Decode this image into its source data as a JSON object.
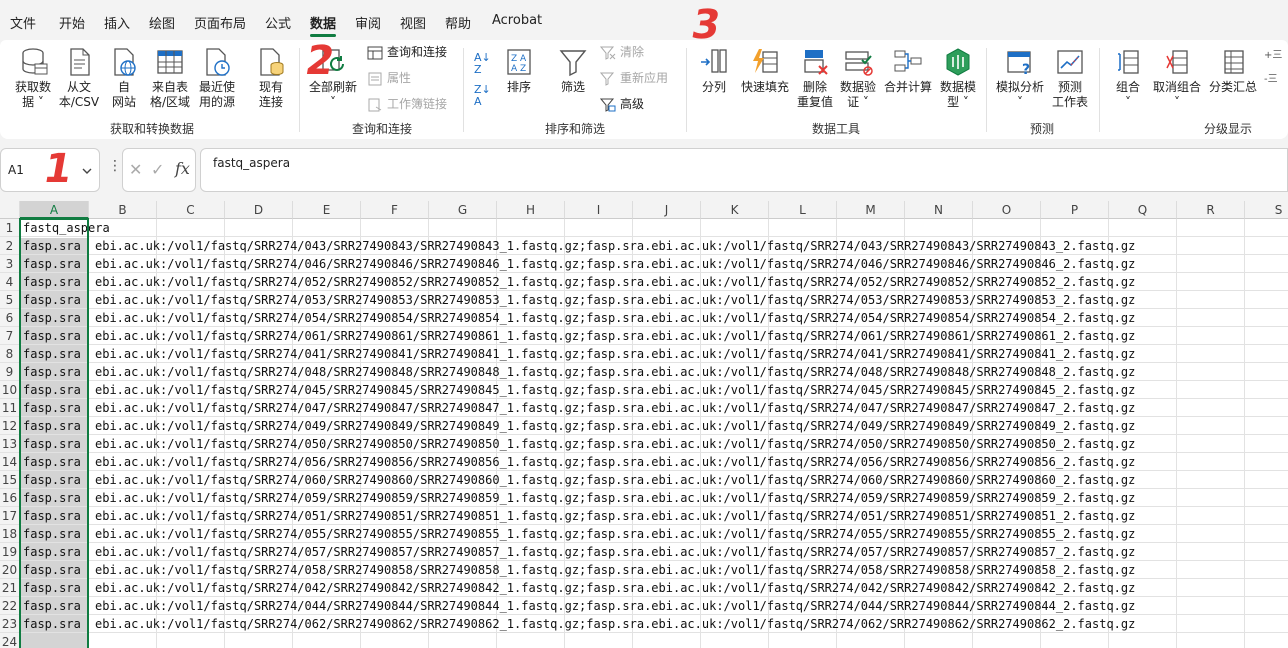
{
  "menu": {
    "tabs": [
      "文件",
      "开始",
      "插入",
      "绘图",
      "页面布局",
      "公式",
      "数据",
      "审阅",
      "视图",
      "帮助",
      "Acrobat"
    ],
    "active": "数据"
  },
  "ribbon": {
    "groups": {
      "get_transform": "获取和转换数据",
      "queries": "查询和连接",
      "sort_filter": "排序和筛选",
      "data_tools": "数据工具",
      "forecast": "预测",
      "outline": "分级显示"
    },
    "buttons": {
      "get_data": "获取数\n据 ˅",
      "from_csv": "从文\n本/CSV",
      "from_web": "自\n网站",
      "from_table": "来自表\n格/区域",
      "recent_sources": "最近使\n用的源",
      "existing_conn": "现有\n连接",
      "refresh_all": "全部刷新\n˅",
      "sort": "排序",
      "filter": "筛选",
      "text_to_columns": "分列",
      "flash_fill": "快速填充",
      "remove_dup": "删除\n重复值",
      "data_validation": "数据验\n证 ˅",
      "consolidate": "合并计算",
      "data_model": "数据模\n型 ˅",
      "what_if": "模拟分析\n˅",
      "forecast_sheet": "预测\n工作表",
      "group": "组合\n˅",
      "ungroup": "取消组合\n˅",
      "subtotal": "分类汇总"
    },
    "small": {
      "queries_conn": "查询和连接",
      "properties": "属性",
      "edit_links": "工作簿链接",
      "clear": "清除",
      "reapply": "重新应用",
      "advanced": "高级"
    }
  },
  "namebox": {
    "value": "A1"
  },
  "formula": {
    "value": "fastq_aspera"
  },
  "columns": [
    "A",
    "B",
    "C",
    "D",
    "E",
    "F",
    "G",
    "H",
    "I",
    "J",
    "K",
    "L",
    "M",
    "N",
    "O",
    "P",
    "Q",
    "R",
    "S"
  ],
  "rows": {
    "header": "fastq_aspera",
    "prefix": "fasp.sra",
    "values": [
      "ebi.ac.uk:/vol1/fastq/SRR274/043/SRR27490843/SRR27490843_1.fastq.gz;fasp.sra.ebi.ac.uk:/vol1/fastq/SRR274/043/SRR27490843/SRR27490843_2.fastq.gz",
      "ebi.ac.uk:/vol1/fastq/SRR274/046/SRR27490846/SRR27490846_1.fastq.gz;fasp.sra.ebi.ac.uk:/vol1/fastq/SRR274/046/SRR27490846/SRR27490846_2.fastq.gz",
      "ebi.ac.uk:/vol1/fastq/SRR274/052/SRR27490852/SRR27490852_1.fastq.gz;fasp.sra.ebi.ac.uk:/vol1/fastq/SRR274/052/SRR27490852/SRR27490852_2.fastq.gz",
      "ebi.ac.uk:/vol1/fastq/SRR274/053/SRR27490853/SRR27490853_1.fastq.gz;fasp.sra.ebi.ac.uk:/vol1/fastq/SRR274/053/SRR27490853/SRR27490853_2.fastq.gz",
      "ebi.ac.uk:/vol1/fastq/SRR274/054/SRR27490854/SRR27490854_1.fastq.gz;fasp.sra.ebi.ac.uk:/vol1/fastq/SRR274/054/SRR27490854/SRR27490854_2.fastq.gz",
      "ebi.ac.uk:/vol1/fastq/SRR274/061/SRR27490861/SRR27490861_1.fastq.gz;fasp.sra.ebi.ac.uk:/vol1/fastq/SRR274/061/SRR27490861/SRR27490861_2.fastq.gz",
      "ebi.ac.uk:/vol1/fastq/SRR274/041/SRR27490841/SRR27490841_1.fastq.gz;fasp.sra.ebi.ac.uk:/vol1/fastq/SRR274/041/SRR27490841/SRR27490841_2.fastq.gz",
      "ebi.ac.uk:/vol1/fastq/SRR274/048/SRR27490848/SRR27490848_1.fastq.gz;fasp.sra.ebi.ac.uk:/vol1/fastq/SRR274/048/SRR27490848/SRR27490848_2.fastq.gz",
      "ebi.ac.uk:/vol1/fastq/SRR274/045/SRR27490845/SRR27490845_1.fastq.gz;fasp.sra.ebi.ac.uk:/vol1/fastq/SRR274/045/SRR27490845/SRR27490845_2.fastq.gz",
      "ebi.ac.uk:/vol1/fastq/SRR274/047/SRR27490847/SRR27490847_1.fastq.gz;fasp.sra.ebi.ac.uk:/vol1/fastq/SRR274/047/SRR27490847/SRR27490847_2.fastq.gz",
      "ebi.ac.uk:/vol1/fastq/SRR274/049/SRR27490849/SRR27490849_1.fastq.gz;fasp.sra.ebi.ac.uk:/vol1/fastq/SRR274/049/SRR27490849/SRR27490849_2.fastq.gz",
      "ebi.ac.uk:/vol1/fastq/SRR274/050/SRR27490850/SRR27490850_1.fastq.gz;fasp.sra.ebi.ac.uk:/vol1/fastq/SRR274/050/SRR27490850/SRR27490850_2.fastq.gz",
      "ebi.ac.uk:/vol1/fastq/SRR274/056/SRR27490856/SRR27490856_1.fastq.gz;fasp.sra.ebi.ac.uk:/vol1/fastq/SRR274/056/SRR27490856/SRR27490856_2.fastq.gz",
      "ebi.ac.uk:/vol1/fastq/SRR274/060/SRR27490860/SRR27490860_1.fastq.gz;fasp.sra.ebi.ac.uk:/vol1/fastq/SRR274/060/SRR27490860/SRR27490860_2.fastq.gz",
      "ebi.ac.uk:/vol1/fastq/SRR274/059/SRR27490859/SRR27490859_1.fastq.gz;fasp.sra.ebi.ac.uk:/vol1/fastq/SRR274/059/SRR27490859/SRR27490859_2.fastq.gz",
      "ebi.ac.uk:/vol1/fastq/SRR274/051/SRR27490851/SRR27490851_1.fastq.gz;fasp.sra.ebi.ac.uk:/vol1/fastq/SRR274/051/SRR27490851/SRR27490851_2.fastq.gz",
      "ebi.ac.uk:/vol1/fastq/SRR274/055/SRR27490855/SRR27490855_1.fastq.gz;fasp.sra.ebi.ac.uk:/vol1/fastq/SRR274/055/SRR27490855/SRR27490855_2.fastq.gz",
      "ebi.ac.uk:/vol1/fastq/SRR274/057/SRR27490857/SRR27490857_1.fastq.gz;fasp.sra.ebi.ac.uk:/vol1/fastq/SRR274/057/SRR27490857/SRR27490857_2.fastq.gz",
      "ebi.ac.uk:/vol1/fastq/SRR274/058/SRR27490858/SRR27490858_1.fastq.gz;fasp.sra.ebi.ac.uk:/vol1/fastq/SRR274/058/SRR27490858/SRR27490858_2.fastq.gz",
      "ebi.ac.uk:/vol1/fastq/SRR274/042/SRR27490842/SRR27490842_1.fastq.gz;fasp.sra.ebi.ac.uk:/vol1/fastq/SRR274/042/SRR27490842/SRR27490842_2.fastq.gz",
      "ebi.ac.uk:/vol1/fastq/SRR274/044/SRR27490844/SRR27490844_1.fastq.gz;fasp.sra.ebi.ac.uk:/vol1/fastq/SRR274/044/SRR27490844/SRR27490844_2.fastq.gz",
      "ebi.ac.uk:/vol1/fastq/SRR274/062/SRR27490862/SRR27490862_1.fastq.gz;fasp.sra.ebi.ac.uk:/vol1/fastq/SRR274/062/SRR27490862/SRR27490862_2.fastq.gz"
    ]
  },
  "annotations": [
    "1",
    "2",
    "3"
  ],
  "colors": {
    "accent": "#107c41",
    "annotation": "#e53935",
    "selection": "#d4d4d4"
  }
}
